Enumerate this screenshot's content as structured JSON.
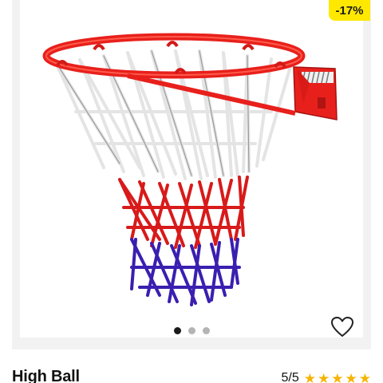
{
  "badge": {
    "discount": "-17%"
  },
  "product": {
    "brand": "High Ball",
    "image_alt": "basketball-hoop-with-net"
  },
  "carousel": {
    "count": 3,
    "active_index": 0
  },
  "rating": {
    "text": "5/5",
    "value": 5,
    "max": 5
  },
  "colors": {
    "badge_bg": "#ffe800",
    "rim": "#e8201c",
    "net_white": "#e6e6e6",
    "net_red": "#d81a1a",
    "net_blue": "#3a1fb0",
    "star": "#f5b400"
  },
  "icons": {
    "wishlist": "heart-outline-icon",
    "star": "star-icon"
  }
}
